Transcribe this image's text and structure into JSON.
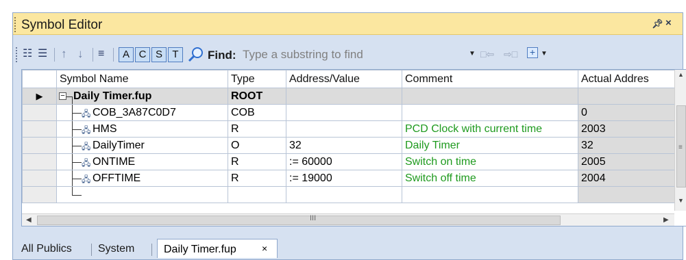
{
  "window": {
    "title": "Symbol Editor",
    "pin_glyph": "⎐",
    "close_glyph": "×"
  },
  "toolbar": {
    "toggles": [
      "A",
      "C",
      "S",
      "T"
    ],
    "find_label": "Find:",
    "find_placeholder": "Type a substring to find",
    "icons": [
      "expand-columns-icon",
      "collapse-columns-icon",
      "move-up-icon",
      "move-down-icon",
      "sort-icon",
      "find-icon",
      "navigate-back-icon",
      "navigate-forward-icon",
      "add-icon"
    ]
  },
  "grid": {
    "columns": [
      "Symbol Name",
      "Type",
      "Address/Value",
      "Comment",
      "Actual Addres"
    ],
    "rows": [
      {
        "name": "Daily Timer.fup",
        "type": "ROOT",
        "address": "",
        "comment": "",
        "actual": ""
      },
      {
        "name": "COB_3A87C0D7",
        "type": "COB",
        "address": "",
        "comment": "",
        "actual": "0"
      },
      {
        "name": "HMS",
        "type": "R",
        "address": "",
        "comment": "PCD Clock with current time",
        "actual": "2003"
      },
      {
        "name": "DailyTimer",
        "type": "O",
        "address": "32",
        "comment": "Daily Timer",
        "actual": "32"
      },
      {
        "name": "ONTIME",
        "type": "R",
        "address": ":= 60000",
        "comment": "Switch on time",
        "actual": "2005"
      },
      {
        "name": "OFFTIME",
        "type": "R",
        "address": ":= 19000",
        "comment": "Switch off time",
        "actual": "2004"
      },
      {
        "name": "",
        "type": "",
        "address": "",
        "comment": "",
        "actual": ""
      }
    ]
  },
  "tabs": [
    {
      "label": "All Publics",
      "active": false
    },
    {
      "label": "System",
      "active": false
    },
    {
      "label": "Daily Timer.fup",
      "active": true,
      "close_glyph": "×"
    }
  ],
  "colors": {
    "title_bar": "#fbe7a0",
    "frame": "#d6e1f1",
    "comment_text": "#1e9a1e",
    "toggle_active": "#c7ddf5"
  }
}
